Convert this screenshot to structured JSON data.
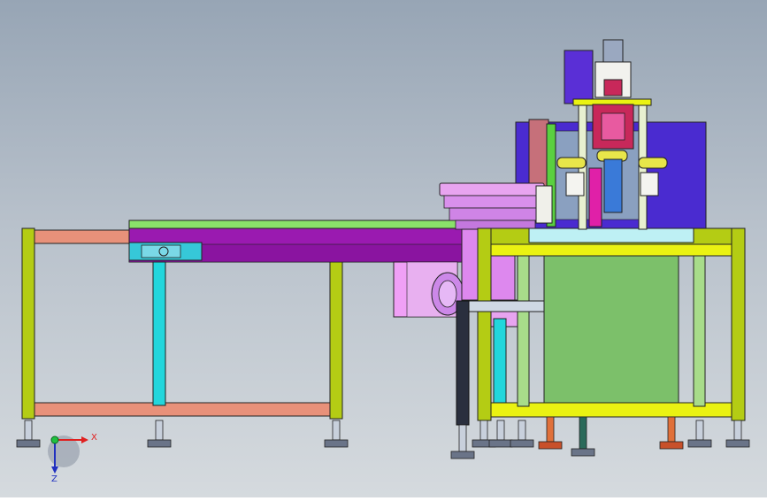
{
  "viewport": {
    "background_top": "#97a5b5",
    "background_bottom": "#d5dade"
  },
  "triad": {
    "x_label": "X",
    "y_label": "Y",
    "z_label": "Z",
    "x_color": "#e02020",
    "y_color": "#20c040",
    "z_color": "#2030c0"
  },
  "model": {
    "frame_green": "#b4cc14",
    "beam_salmon": "#e8917a",
    "conveyor_purple": "#9a1ab0",
    "bowl_pink": "#dd88ee",
    "cabinet_green": "#7cc06a",
    "cyan_post": "#22d6dc",
    "yellow_rail": "#eaf212",
    "press_blue": "#4a2bd0"
  }
}
